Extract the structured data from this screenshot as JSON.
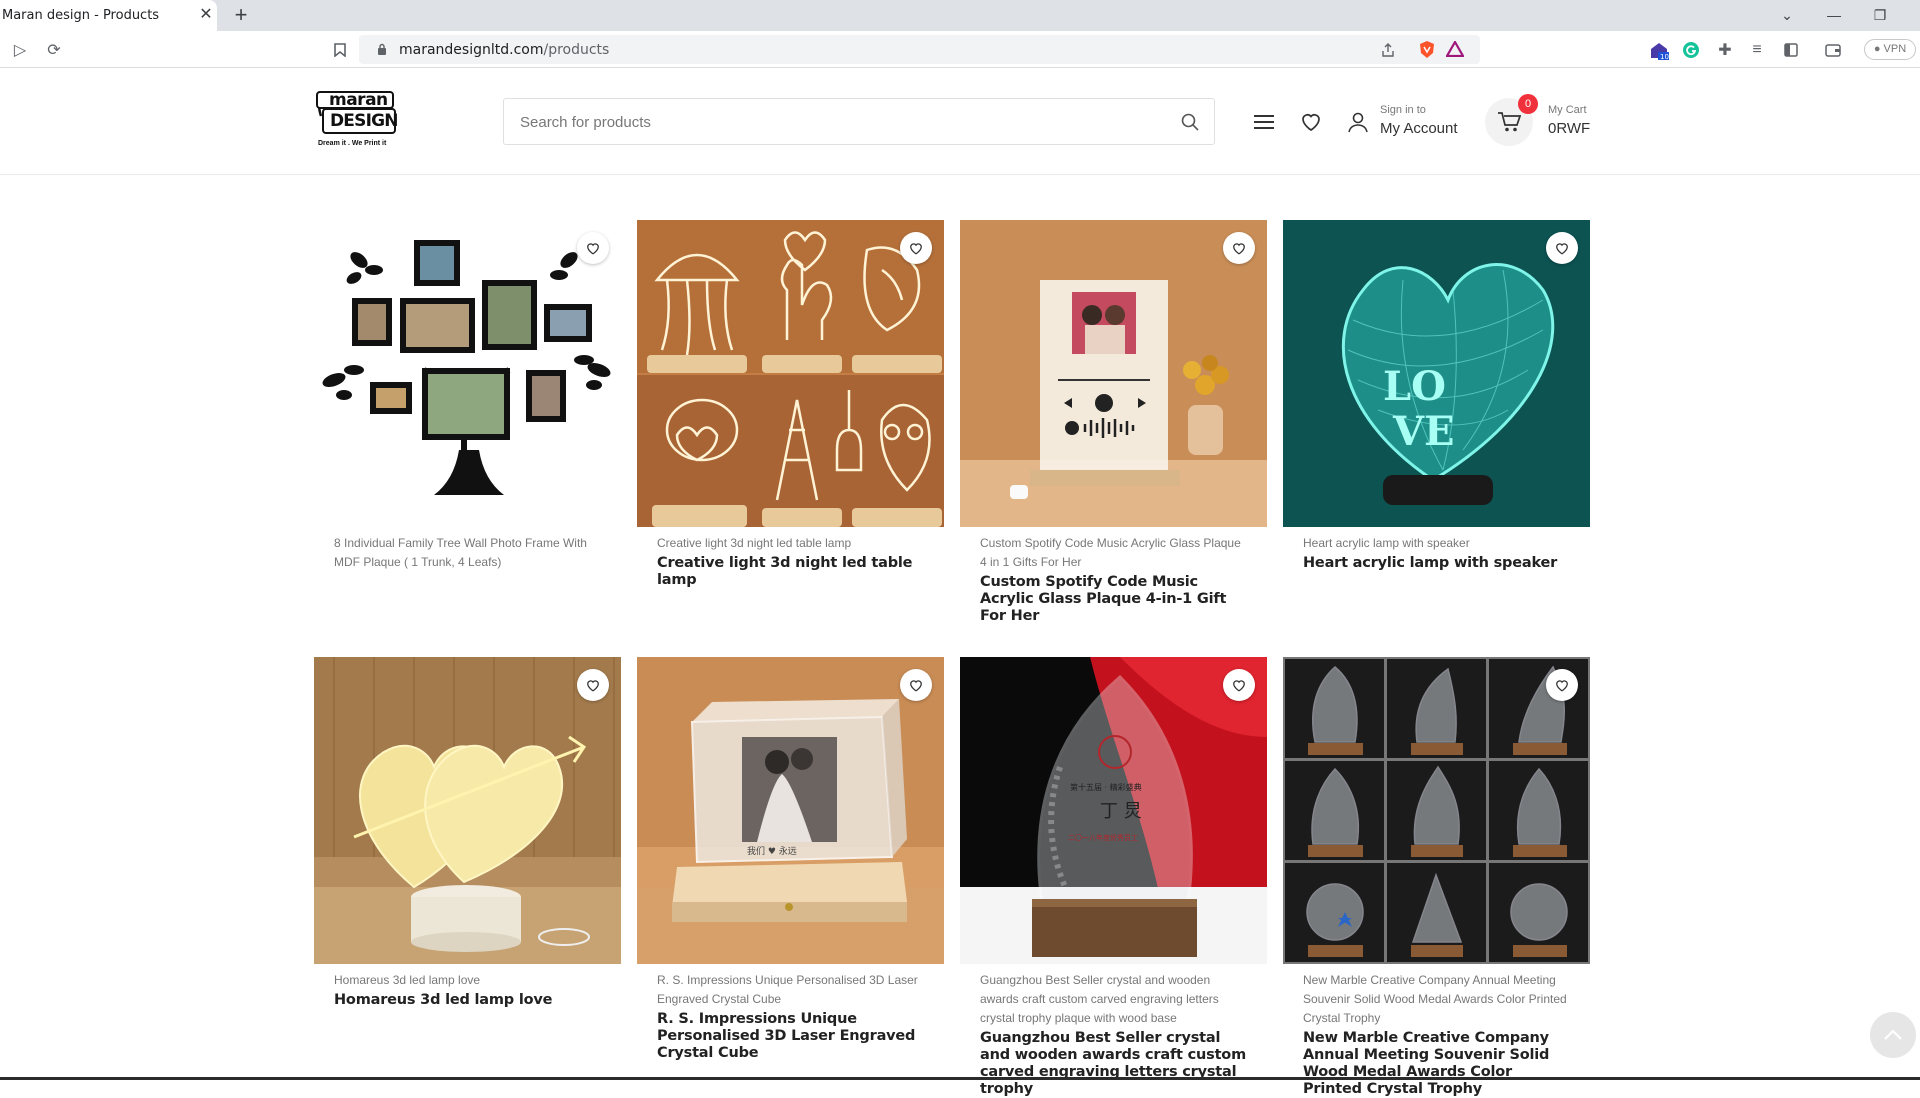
{
  "browser": {
    "tab_title": "Maran design - Products",
    "tab_close": "✕",
    "new_tab": "+",
    "url_domain": "marandesignltd.com",
    "url_path": "/products",
    "vpn_label": "● VPN"
  },
  "header": {
    "logo_text_top": "maran",
    "logo_text_bottom": "DESIGN",
    "logo_tagline": "Dream it . We Print it",
    "search_placeholder": "Search for products",
    "account_small": "Sign in to",
    "account_big": "My Account",
    "cart_count": "0",
    "cart_small": "My Cart",
    "cart_big": "0RWF"
  },
  "products": [
    {
      "subtitle": "8 Individual Family Tree Wall Photo Frame With MDF Plaque ( 1 Trunk, 4 Leafs)",
      "title": "",
      "image_icon": "family-tree-frame-image"
    },
    {
      "subtitle": "Creative light 3d night led table lamp",
      "title": "Creative light 3d night led table lamp",
      "image_icon": "3d-lamps-image"
    },
    {
      "subtitle": "Custom Spotify Code Music Acrylic Glass Plaque 4 in 1 Gifts For Her",
      "title": "Custom Spotify Code Music Acrylic Glass Plaque 4-in-1 Gift For Her",
      "image_icon": "spotify-plaque-image"
    },
    {
      "subtitle": "Heart acrylic lamp with speaker",
      "title": "Heart acrylic lamp with speaker",
      "image_icon": "heart-lamp-image"
    },
    {
      "subtitle": "Homareus 3d led lamp love",
      "title": "Homareus 3d led lamp love",
      "image_icon": "love-lamp-image"
    },
    {
      "subtitle": "R. S. Impressions Unique Personalised 3D Laser Engraved Crystal Cube",
      "title": "R. S. Impressions Unique Personalised 3D Laser Engraved Crystal Cube",
      "image_icon": "crystal-cube-image"
    },
    {
      "subtitle": "Guangzhou Best Seller crystal and wooden awards craft custom carved engraving letters crystal trophy plaque with wood base",
      "title": "Guangzhou Best Seller crystal and wooden awards craft custom carved engraving letters crystal trophy",
      "image_icon": "crystal-trophy-image"
    },
    {
      "subtitle": "New Marble Creative Company Annual Meeting Souvenir Solid Wood Medal Awards Color Printed Crystal Trophy",
      "title": "New Marble Creative Company Annual Meeting Souvenir Solid Wood Medal Awards Color Printed Crystal Trophy",
      "image_icon": "trophy-collection-image"
    }
  ],
  "colors": {
    "badge": "#f0303a",
    "accent_text": "#222222",
    "muted_text": "#777777"
  }
}
